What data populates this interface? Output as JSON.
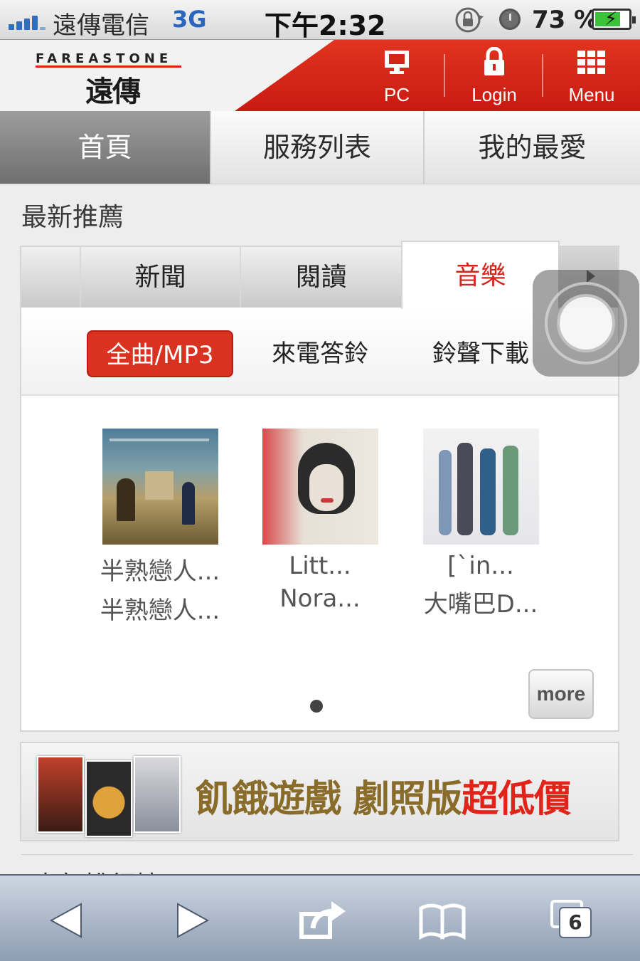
{
  "status_bar": {
    "carrier": "遠傳電信",
    "network": "3G",
    "time": "下午2:32",
    "battery_percent": "73 %",
    "battery_level": 0.73,
    "icons": [
      "signal-icon",
      "rotation-lock-icon",
      "alarm-icon",
      "battery-charging-icon"
    ]
  },
  "header": {
    "logo_en": "FAREASTONE",
    "logo_zh": "遠傳",
    "pc_label": "PC",
    "login_label": "Login",
    "menu_label": "Menu",
    "accent_color": "#d3241a"
  },
  "main_tabs": [
    {
      "label": "首頁",
      "active": true
    },
    {
      "label": "服務列表",
      "active": false
    },
    {
      "label": "我的最愛",
      "active": false
    }
  ],
  "section": {
    "title": "最新推薦",
    "tabs": [
      {
        "label": "新聞",
        "active": false
      },
      {
        "label": "閱讀",
        "active": false
      },
      {
        "label": "音樂",
        "active": true
      }
    ],
    "filters": [
      {
        "label": "全曲/MP3",
        "active": true
      },
      {
        "label": "來電答鈴",
        "active": false
      },
      {
        "label": "鈴聲下載",
        "active": false
      }
    ],
    "albums": [
      {
        "title": "半熟戀人...",
        "artist": "半熟戀人..."
      },
      {
        "title": "Litt...",
        "artist": "Nora..."
      },
      {
        "title": "[`in...",
        "artist": "大嘴巴D..."
      }
    ],
    "more_label": "more",
    "page_index": 1,
    "page_count": 1
  },
  "banner": {
    "text_main": "飢餓遊戲 劇照版",
    "text_highlight": "超低價"
  },
  "next_heading_partial": "本年排行榜",
  "toolbar": {
    "tabs_count": "6",
    "icons": [
      "back-icon",
      "forward-icon",
      "share-icon",
      "bookmarks-icon",
      "tabs-icon"
    ]
  }
}
